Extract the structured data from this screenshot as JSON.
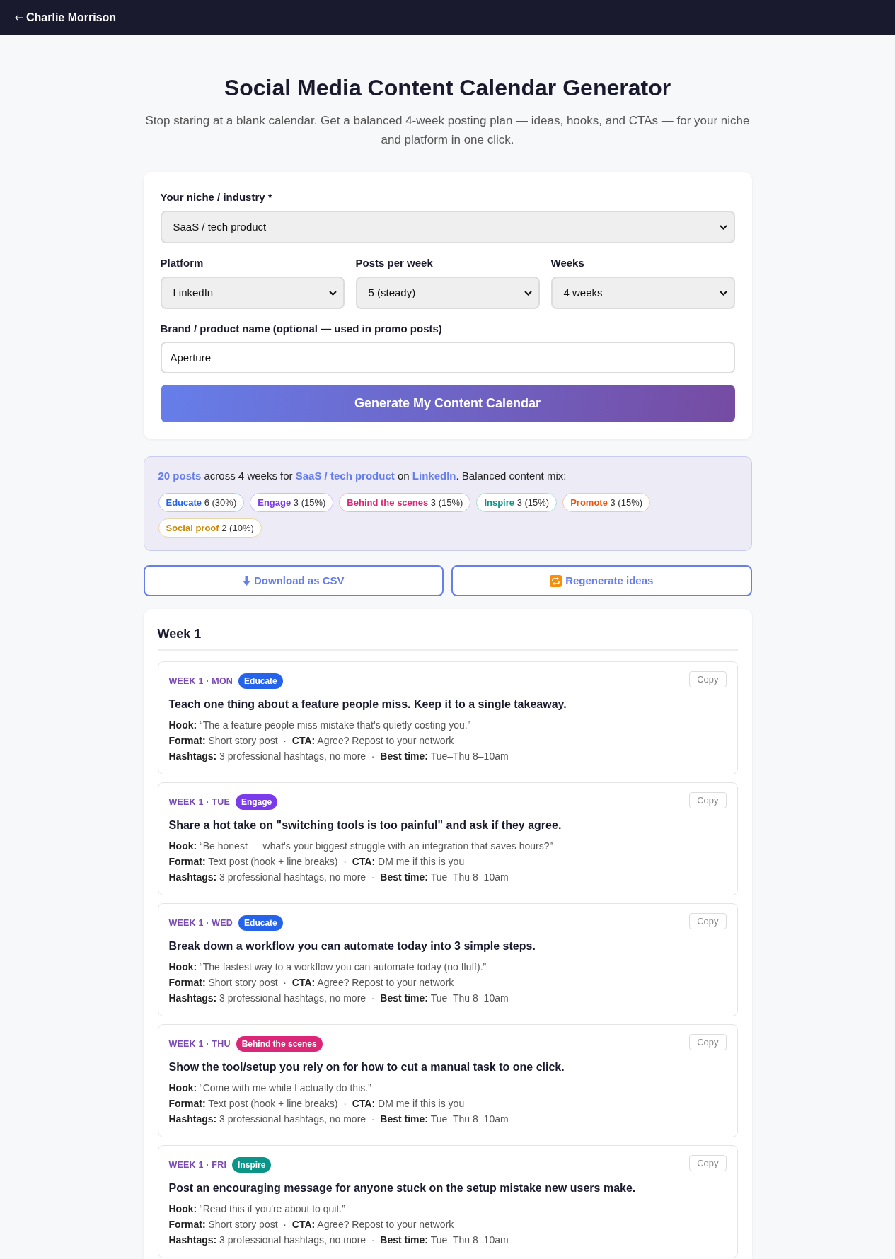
{
  "header": {
    "back_link": "Charlie Morrison"
  },
  "hero": {
    "title": "Social Media Content Calendar Generator",
    "subtitle": "Stop staring at a blank calendar. Get a balanced 4-week posting plan — ideas, hooks, and CTAs — for your niche and platform in one click."
  },
  "form": {
    "niche": {
      "label": "Your niche / industry *",
      "value": "SaaS / tech product"
    },
    "selects": [
      {
        "label": "Platform",
        "value": "LinkedIn"
      },
      {
        "label": "Posts per week",
        "value": "5 (steady)"
      },
      {
        "label": "Weeks",
        "value": "4 weeks"
      }
    ],
    "brand": {
      "label": "Brand / product name (optional — used in promo posts)",
      "value": "Aperture"
    },
    "submit": "Generate My Content Calendar"
  },
  "summary": {
    "text": "**20 posts** across 4 weeks for **SaaS / tech product** on **LinkedIn**. Balanced content mix:",
    "mix": [
      {
        "label": "Educate",
        "count": "6 (30%)",
        "color": "#2563eb"
      },
      {
        "label": "Engage",
        "count": "3 (15%)",
        "color": "#7c3aed"
      },
      {
        "label": "Behind the scenes",
        "count": "3 (15%)",
        "color": "#db2777"
      },
      {
        "label": "Inspire",
        "count": "3 (15%)",
        "color": "#0d9488"
      },
      {
        "label": "Promote",
        "count": "3 (15%)",
        "color": "#ea580c"
      },
      {
        "label": "Social proof",
        "count": "2 (10%)",
        "color": "#ca8a04"
      }
    ]
  },
  "actions": [
    {
      "kind": "download",
      "label": "Download as CSV"
    },
    {
      "kind": "regenerate",
      "label": "Regenerate ideas"
    }
  ],
  "weeks": [
    {
      "title": "Week 1",
      "posts": [
        {
          "meta": "WEEK 1 · MON",
          "tag": "Educate",
          "color": "#2563eb",
          "copy": "Copy",
          "title": "Teach one thing about a feature people miss. Keep it to a single takeaway.",
          "lines": [
            "**Hook:** “The a feature people miss mistake that's quietly costing you.”",
            "**Format:** Short story post  ·  **CTA:** Agree? Repost to your network",
            "**Hashtags:** 3 professional hashtags, no more  ·  **Best time:** Tue–Thu 8–10am"
          ]
        },
        {
          "meta": "WEEK 1 · TUE",
          "tag": "Engage",
          "color": "#7c3aed",
          "copy": "Copy",
          "title": "Share a hot take on \"switching tools is too painful\" and ask if they agree.",
          "lines": [
            "**Hook:** “Be honest — what's your biggest struggle with an integration that saves hours?”",
            "**Format:** Text post (hook + line breaks)  ·  **CTA:** DM me if this is you",
            "**Hashtags:** 3 professional hashtags, no more  ·  **Best time:** Tue–Thu 8–10am"
          ]
        },
        {
          "meta": "WEEK 1 · WED",
          "tag": "Educate",
          "color": "#2563eb",
          "copy": "Copy",
          "title": "Break down a workflow you can automate today into 3 simple steps.",
          "lines": [
            "**Hook:** “The fastest way to a workflow you can automate today (no fluff).”",
            "**Format:** Short story post  ·  **CTA:** Agree? Repost to your network",
            "**Hashtags:** 3 professional hashtags, no more  ·  **Best time:** Tue–Thu 8–10am"
          ]
        },
        {
          "meta": "WEEK 1 · THU",
          "tag": "Behind the scenes",
          "color": "#db2777",
          "copy": "Copy",
          "title": "Show the tool/setup you rely on for how to cut a manual task to one click.",
          "lines": [
            "**Hook:** “Come with me while I actually do this.”",
            "**Format:** Text post (hook + line breaks)  ·  **CTA:** DM me if this is you",
            "**Hashtags:** 3 professional hashtags, no more  ·  **Best time:** Tue–Thu 8–10am"
          ]
        },
        {
          "meta": "WEEK 1 · FRI",
          "tag": "Inspire",
          "color": "#0d9488",
          "copy": "Copy",
          "title": "Post an encouraging message for anyone stuck on the setup mistake new users make.",
          "lines": [
            "**Hook:** “Read this if you're about to quit.”",
            "**Format:** Short story post  ·  **CTA:** Agree? Repost to your network",
            "**Hashtags:** 3 professional hashtags, no more  ·  **Best time:** Tue–Thu 8–10am"
          ]
        }
      ]
    }
  ]
}
